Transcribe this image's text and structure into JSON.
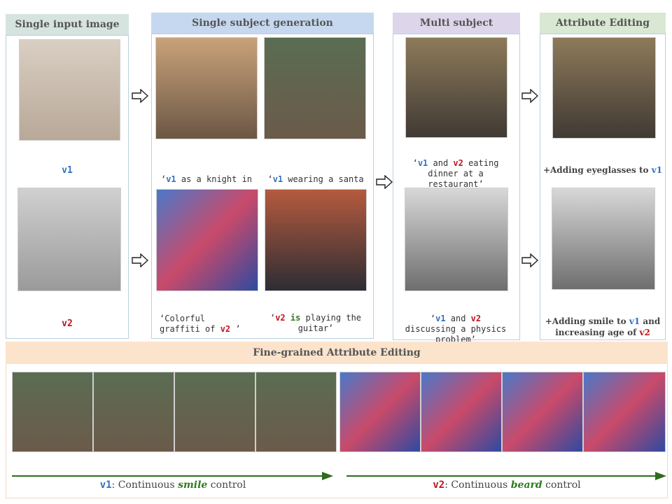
{
  "panels": {
    "single_input": {
      "title": "Single input image",
      "v1_label": "v1",
      "v2_label": "v2"
    },
    "single_subject": {
      "title": "Single subject generation",
      "prompts": [
        {
          "tag": "v1",
          "pre": "‘",
          "rest": " as a knight in plate armor’"
        },
        {
          "tag": "v1",
          "pre": "‘",
          "rest": " wearing a santa hat in a snowy forest’"
        },
        {
          "pre": "‘Colorful graffiti of ",
          "tag": "v2",
          "rest": " ’"
        },
        {
          "pre": "‘",
          "tag": "v2",
          "mid": " is",
          "rest": " playing the guitar’"
        }
      ]
    },
    "multi_subject": {
      "title": "Multi subject generation",
      "prompts": [
        {
          "pre": "‘",
          "tag1": "v1",
          "mid": " and ",
          "tag2": "v2",
          "rest": " eating dinner at a restaurant’"
        },
        {
          "pre": "‘",
          "tag1": "v1",
          "mid": " and ",
          "tag2": "v2",
          "rest": " discussing a physics problem’"
        }
      ]
    },
    "attribute_editing": {
      "title": "Attribute Editing",
      "edit1": {
        "pre": "+Adding eyeglasses to ",
        "tag": "v1"
      },
      "edit2": {
        "pre": "+Adding smile to ",
        "tag1": "v1",
        "mid": " and increasing age of ",
        "tag2": "v2"
      }
    }
  },
  "fine_grained": {
    "title": "Fine-grained Attribute Editing",
    "left": {
      "tag": "v1",
      "pre": ": Continuous ",
      "attr": "smile",
      "post": " control"
    },
    "right": {
      "tag": "v2",
      "pre": ": Continuous ",
      "attr": "beard",
      "post": " control"
    }
  },
  "colors": {
    "v1": "#3070c0",
    "v2": "#c0141c",
    "attribute": "#2e7a1e",
    "title_single_input": "#d6e4e0",
    "title_single_subject": "#c6d8ef",
    "title_multi_subject": "#ddd6ea",
    "title_attribute": "#d8e8d2",
    "title_fine_grained": "#fbe3cc"
  }
}
